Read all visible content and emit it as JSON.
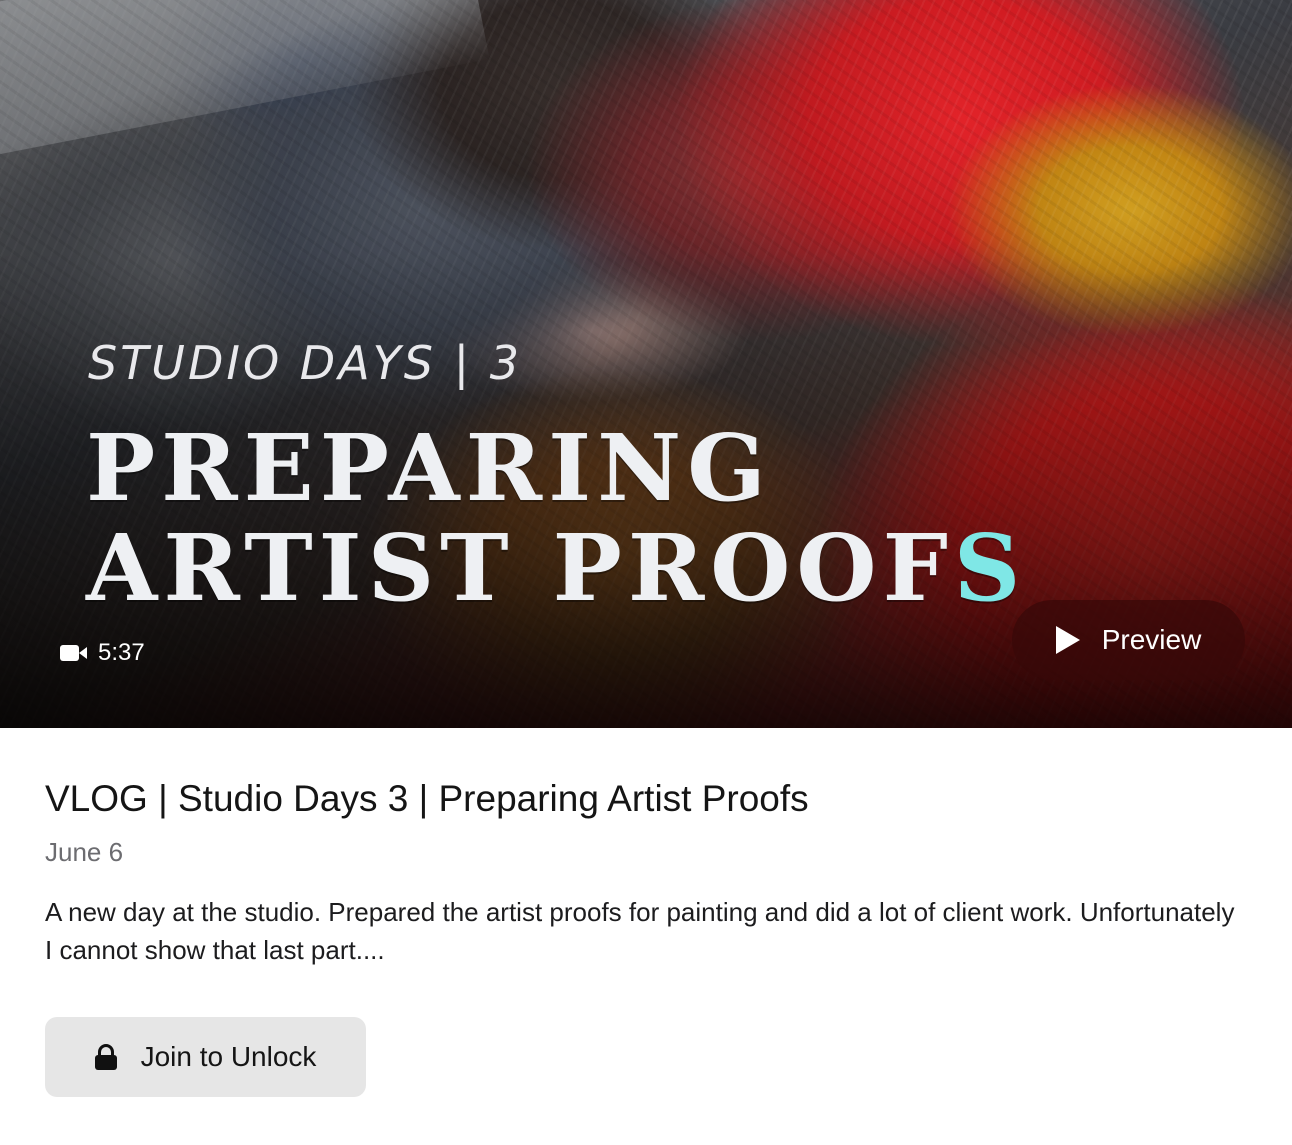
{
  "thumbnail": {
    "overlay_kicker": "STUDIO DAYS | 3",
    "overlay_title_line1": "PREPARING",
    "overlay_title_line2_main": "ARTIST PROOF",
    "overlay_title_line2_accent": "S",
    "duration": "5:37",
    "duration_icon": "video-camera-icon",
    "preview_label": "Preview",
    "preview_icon": "play-icon"
  },
  "post": {
    "title": "VLOG | Studio Days 3 | Preparing Artist Proofs",
    "date": "June 6",
    "description": "A new day at the studio. Prepared the artist proofs for painting and did a lot of client work. Unfortunately I cannot show that last part...."
  },
  "actions": {
    "join_label": "Join to Unlock",
    "join_icon": "lock-icon"
  },
  "colors": {
    "accent_cyan": "#7fe7e6",
    "join_button_bg": "#e6e6e6",
    "preview_button_bg": "rgba(55, 8, 8, 0.72)"
  }
}
